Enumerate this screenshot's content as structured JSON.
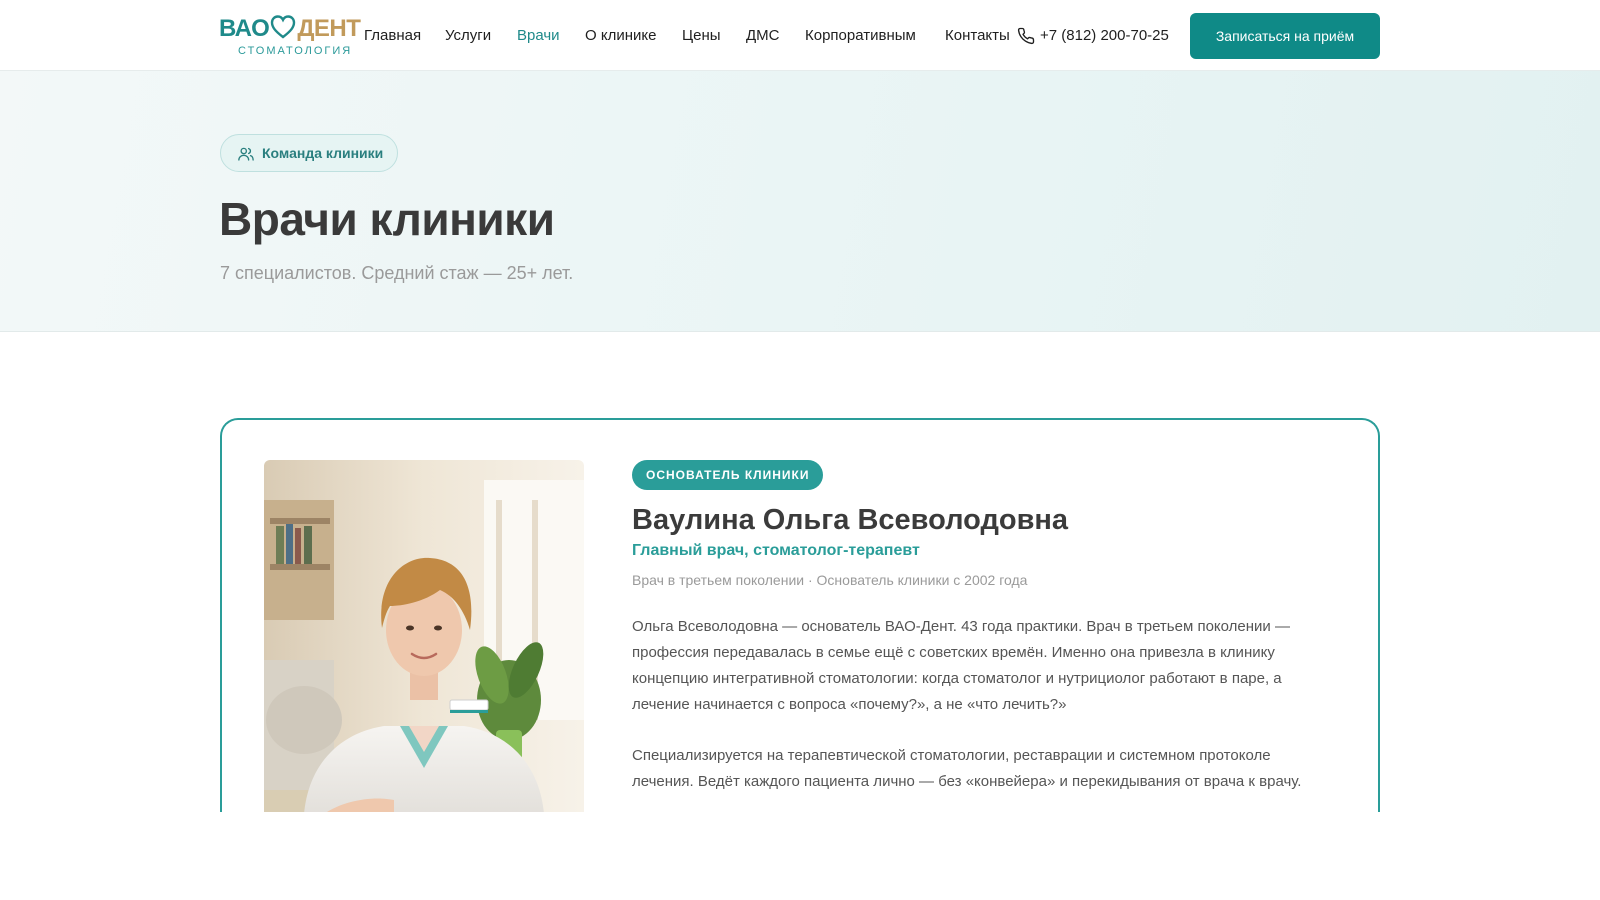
{
  "header": {
    "logo": {
      "left": "ВАО",
      "right": "ДЕНТ",
      "sub": "СТОМАТОЛОГИЯ"
    },
    "nav": [
      {
        "label": "Главная",
        "active": false
      },
      {
        "label": "Услуги",
        "active": false
      },
      {
        "label": "Врачи",
        "active": true
      },
      {
        "label": "О клинике",
        "active": false
      },
      {
        "label": "Цены",
        "active": false
      },
      {
        "label": "ДМС",
        "active": false
      },
      {
        "label": "Корпоративным",
        "active": false
      },
      {
        "label": "Контакты",
        "active": false
      }
    ],
    "phone": "+7 (812) 200-70-25",
    "cta": "Записаться на приём"
  },
  "hero": {
    "pill": "Команда клиники",
    "title": "Врачи клиники",
    "subtitle": "7 специалистов. Средний стаж — 25+ лет."
  },
  "doctor": {
    "badge": "ОСНОВАТЕЛЬ КЛИНИКИ",
    "name": "Ваулина Ольга Всеволодовна",
    "role": "Главный врач, стоматолог-терапевт",
    "meta": "Врач в третьем поколении · Основатель клиники с 2002 года",
    "paragraphs": [
      "Ольга Всеволодовна — основатель ВАО-Дент. 43 года практики. Врач в третьем поколении — профессия передавалась в семье ещё с советских времён. Именно она привезла в клинику концепцию интегративной стоматологии: когда стоматолог и нутрициолог работают в паре, а лечение начинается с вопроса «почему?», а не «что лечить?»",
      "Специализируется на терапевтической стоматологии, реставрации и системном протоколе лечения. Ведёт каждого пациента лично — без «конвейера» и перекидывания от врача к врачу."
    ]
  },
  "colors": {
    "accent": "#0f8a87",
    "accent_light": "#2a9d99",
    "logo_gold": "#c19a5b",
    "text_dark": "#3a3a3a",
    "text_muted": "#9a9a9a"
  },
  "icons": {
    "phone": "phone-icon",
    "team": "users-icon",
    "logo": "heart-tooth-icon"
  }
}
